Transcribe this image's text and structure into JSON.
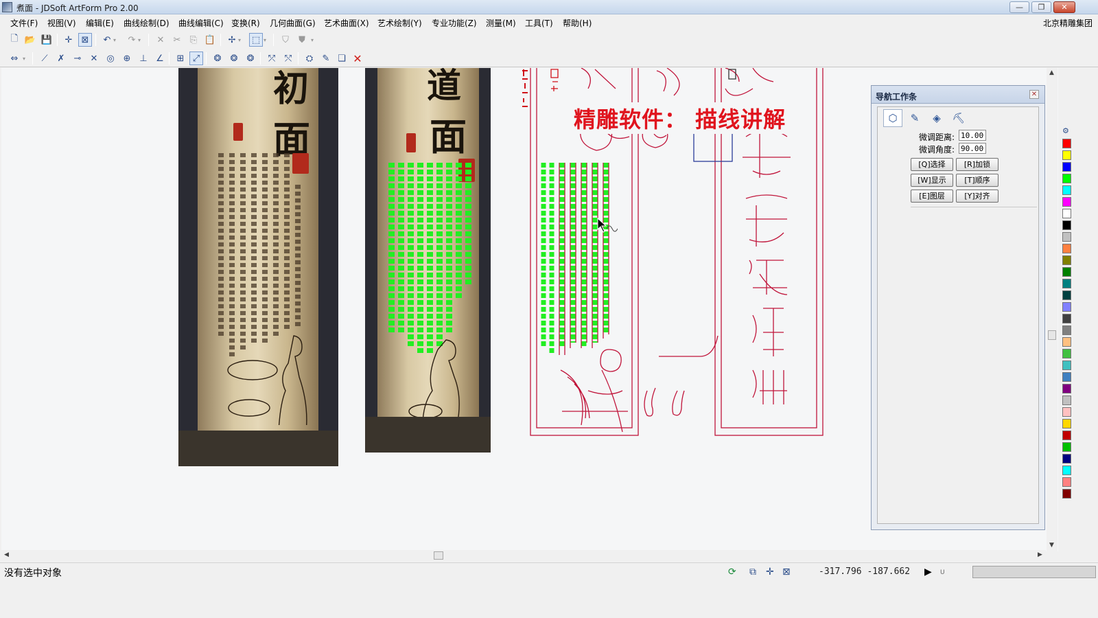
{
  "window": {
    "title": "煮面 - JDSoft ArtForm Pro 2.00",
    "controls": {
      "minimize": "—",
      "restore": "❐",
      "close": "✕"
    }
  },
  "menu": {
    "items": [
      "文件(F)",
      "视图(V)",
      "编辑(E)",
      "曲线绘制(D)",
      "曲线编辑(C)",
      "变换(R)",
      "几何曲面(G)",
      "艺术曲面(X)",
      "艺术绘制(Y)",
      "专业功能(Z)",
      "测量(M)",
      "工具(T)",
      "帮助(H)"
    ],
    "company": "北京精雕集团"
  },
  "toolbar1": {
    "icons": [
      "new-icon",
      "open-icon",
      "save-icon",
      "snap-point-icon",
      "select-box-icon",
      "undo-icon",
      "redo-icon",
      "cut-disabled-icon",
      "cut-icon",
      "copy-icon",
      "paste-icon",
      "crosshair-icon",
      "view-3d-icon",
      "render-icon",
      "shade-icon"
    ]
  },
  "toolbar2": {
    "icons": [
      "move-icon",
      "line-icon",
      "trim-icon",
      "extend-icon",
      "intersect-icon",
      "circle-icon",
      "circle-tangent-icon",
      "perpendicular-icon",
      "angle-icon",
      "grid-icon",
      "chart-icon",
      "blob1-icon",
      "blob2-icon",
      "blob3-icon",
      "node-add-icon",
      "node-delete-icon",
      "relief-icon",
      "paint-icon",
      "layers-icon",
      "delete-icon"
    ]
  },
  "canvas": {
    "banner_text": "精雕软件：  描线讲解"
  },
  "nav_panel": {
    "title": "导航工作条",
    "close": "✕",
    "tabs": [
      "layer-tab-icon",
      "edit-tab-icon",
      "surface-tab-icon",
      "tool-tab-icon"
    ],
    "fine_distance_label": "微调距离:",
    "fine_distance_value": "10.000",
    "fine_angle_label": "微调角度:",
    "fine_angle_value": "90.000",
    "buttons": [
      "[Q]选择",
      "[R]加锁",
      "[W]显示",
      "[T]顺序",
      "[E]图层",
      "[Y]对齐"
    ]
  },
  "palette": {
    "colors": [
      "#ff0000",
      "#ffff00",
      "#0000ff",
      "#00ff00",
      "#00ffff",
      "#ff00ff",
      "#ffffff",
      "#000000",
      "#c0c0c0",
      "#ff8040",
      "#808000",
      "#008000",
      "#008080",
      "#004040",
      "#8080ff",
      "#404040",
      "#808080",
      "#ffc080",
      "#40c040",
      "#40c0c0",
      "#4080c0",
      "#800080",
      "#c0c0c0",
      "#ffc0c0",
      "#ffd700",
      "#c00000",
      "#00c000",
      "#000080",
      "#00ffff",
      "#ff8080",
      "#800000"
    ]
  },
  "status": {
    "message": "没有选中对象",
    "coordinates": "-317.796  -187.662",
    "unit_marker": "U"
  }
}
